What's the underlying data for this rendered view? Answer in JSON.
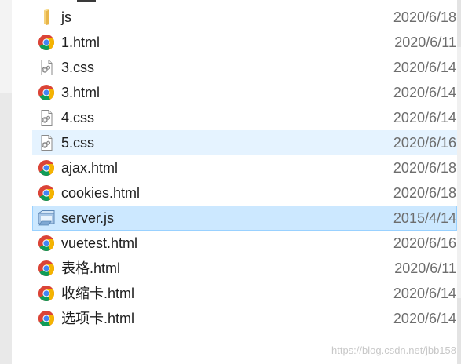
{
  "files": [
    {
      "name": "js",
      "date": "2020/6/18",
      "type": "folder",
      "state": "normal"
    },
    {
      "name": "1.html",
      "date": "2020/6/11",
      "type": "chrome",
      "state": "normal"
    },
    {
      "name": "3.css",
      "date": "2020/6/14",
      "type": "css",
      "state": "normal"
    },
    {
      "name": "3.html",
      "date": "2020/6/14",
      "type": "chrome",
      "state": "normal"
    },
    {
      "name": "4.css",
      "date": "2020/6/14",
      "type": "css",
      "state": "normal"
    },
    {
      "name": "5.css",
      "date": "2020/6/16",
      "type": "css",
      "state": "hover"
    },
    {
      "name": "ajax.html",
      "date": "2020/6/18",
      "type": "chrome",
      "state": "normal"
    },
    {
      "name": "cookies.html",
      "date": "2020/6/18",
      "type": "chrome",
      "state": "normal"
    },
    {
      "name": "server.js",
      "date": "2015/4/14",
      "type": "js",
      "state": "selected"
    },
    {
      "name": "vuetest.html",
      "date": "2020/6/16",
      "type": "chrome",
      "state": "normal"
    },
    {
      "name": "表格.html",
      "date": "2020/6/11",
      "type": "chrome",
      "state": "normal"
    },
    {
      "name": "收缩卡.html",
      "date": "2020/6/14",
      "type": "chrome",
      "state": "normal"
    },
    {
      "name": "选项卡.html",
      "date": "2020/6/14",
      "type": "chrome",
      "state": "normal"
    }
  ],
  "icons": {
    "folder": "folder-icon",
    "chrome": "chrome-icon",
    "css": "css-file-icon",
    "js": "js-script-icon"
  },
  "colors": {
    "hover_bg": "#e5f3ff",
    "selected_bg": "#cce8ff",
    "selected_border": "#99d1ff",
    "date_text": "#6d6d6d"
  },
  "watermark": "https://blog.csdn.net/jbb158"
}
